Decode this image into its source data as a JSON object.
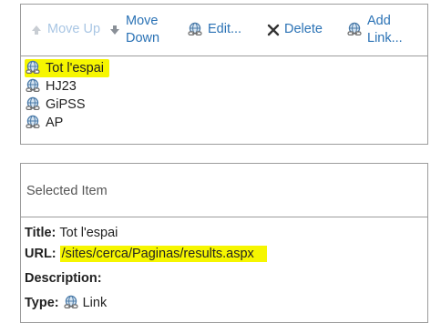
{
  "toolbar": {
    "move_up": "Move Up",
    "move_down_line1": "Move",
    "move_down_line2": "Down",
    "edit": "Edit...",
    "delete": "Delete",
    "add_link_line1": "Add",
    "add_link_line2": "Link..."
  },
  "links": [
    {
      "label": "Tot l'espai",
      "selected": true
    },
    {
      "label": "HJ23",
      "selected": false
    },
    {
      "label": "GiPSS",
      "selected": false
    },
    {
      "label": "AP",
      "selected": false
    }
  ],
  "selected_item": {
    "header": "Selected Item",
    "title_label": "Title:",
    "title_value": "Tot l'espai",
    "url_label": "URL:",
    "url_value": "/sites/cerca/Paginas/results.aspx",
    "description_label": "Description:",
    "description_value": "",
    "type_label": "Type:",
    "type_value": "Link"
  },
  "colors": {
    "link_blue": "#2a72b5",
    "disabled_blue": "#a9c6e4",
    "highlight": "#f6f600",
    "border": "#9c9c9c"
  },
  "icons": {
    "move_up": "arrow-up-icon",
    "move_down": "arrow-down-icon",
    "edit": "link-globe-icon",
    "delete": "x-icon",
    "add_link": "link-globe-icon",
    "list_item": "link-globe-icon"
  }
}
